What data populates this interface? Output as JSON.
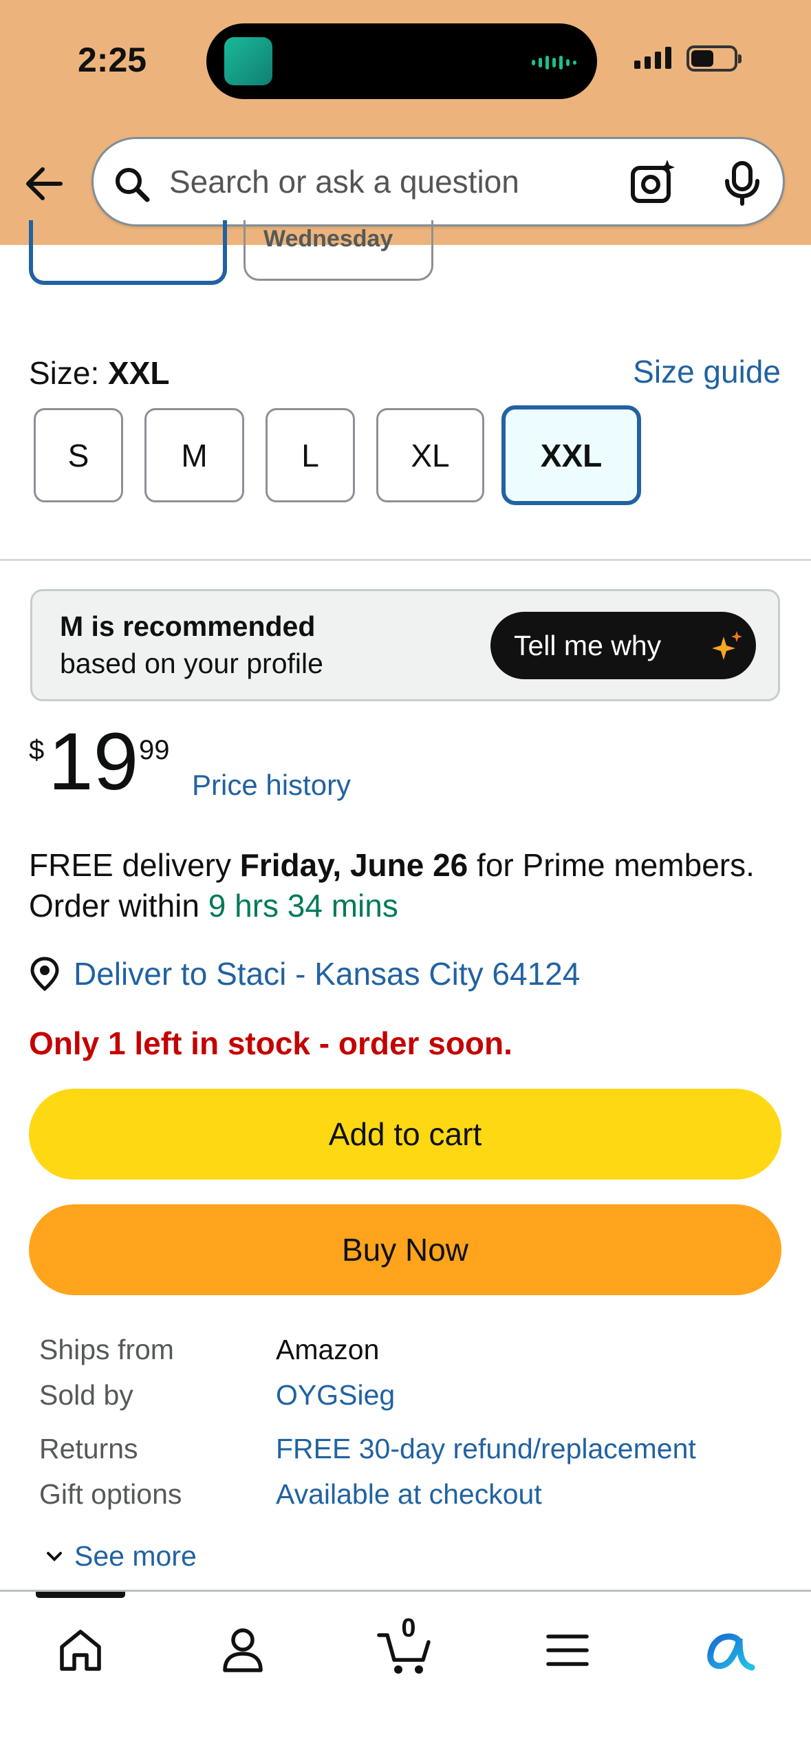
{
  "status_bar": {
    "time": "2:25",
    "accent": "#ecb47c"
  },
  "search": {
    "placeholder": "Search or ask a question"
  },
  "prev_options": {
    "chip2_label": "Wednesday"
  },
  "size": {
    "label": "Size: ",
    "selected": "XXL",
    "guide_label": "Size guide",
    "options": [
      "S",
      "M",
      "L",
      "XL",
      "XXL"
    ]
  },
  "recommendation": {
    "title": "M is recommended",
    "subtitle": "based on your profile",
    "button_label": "Tell me why"
  },
  "price": {
    "currency": "$",
    "whole": "19",
    "fraction": "99",
    "history_label": "Price history"
  },
  "delivery": {
    "prefix": "FREE delivery ",
    "date": "Friday, June 26",
    "suffix": " for Prime members.",
    "order_within": "Order within ",
    "countdown": "9 hrs 34 mins",
    "deliver_to": "Deliver to Staci - Kansas City 64124"
  },
  "stock": "Only 1 left in stock - order soon.",
  "actions": {
    "add_to_cart": "Add to cart",
    "buy_now": "Buy Now"
  },
  "details": [
    {
      "key": "Ships from",
      "value": "Amazon"
    },
    {
      "key": "Sold by",
      "value": "OYGSieg"
    },
    {
      "key": "Returns",
      "value": "FREE 30-day refund/replacement"
    },
    {
      "key": "Gift options",
      "value": "Available at checkout"
    }
  ],
  "see_more": "See more",
  "tabbar": {
    "cart_count": "0",
    "icons": [
      "home-icon",
      "account-icon",
      "cart-icon",
      "menu-icon",
      "rufus-ai-icon"
    ]
  }
}
